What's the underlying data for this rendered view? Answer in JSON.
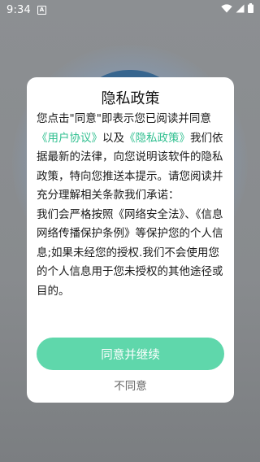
{
  "status_bar": {
    "time": "9:34",
    "notification_icon": "a-icon",
    "wifi_icon": "wifi-icon",
    "signal_icon": "signal-icon",
    "battery_icon": "battery-icon"
  },
  "dialog": {
    "title": "隐私政策",
    "body": {
      "intro": "您点击\"同意\"即表示您已阅读并同意",
      "link_user_agreement": "《用户协议》",
      "connector": "以及",
      "link_privacy_policy": "《隐私政策》",
      "para1": "我们依据最新的法律，向您说明该软件的隐私政策，特向您推送本提示。请您阅读并充分理解相关条款我们承诺：",
      "para2_prefix": "我们会严格按照《网络安全法》、《信息网络传播保护条例》等保护您的个人信息;如果未经您的授权.我们不会使用您的个人信息用于您未授权的其他途径或目的。"
    },
    "agree_label": "同意并继续",
    "disagree_label": "不同意"
  },
  "colors": {
    "accent": "#5fd7ab",
    "link": "#2fbf8f",
    "overlay": "#8a8d90"
  }
}
